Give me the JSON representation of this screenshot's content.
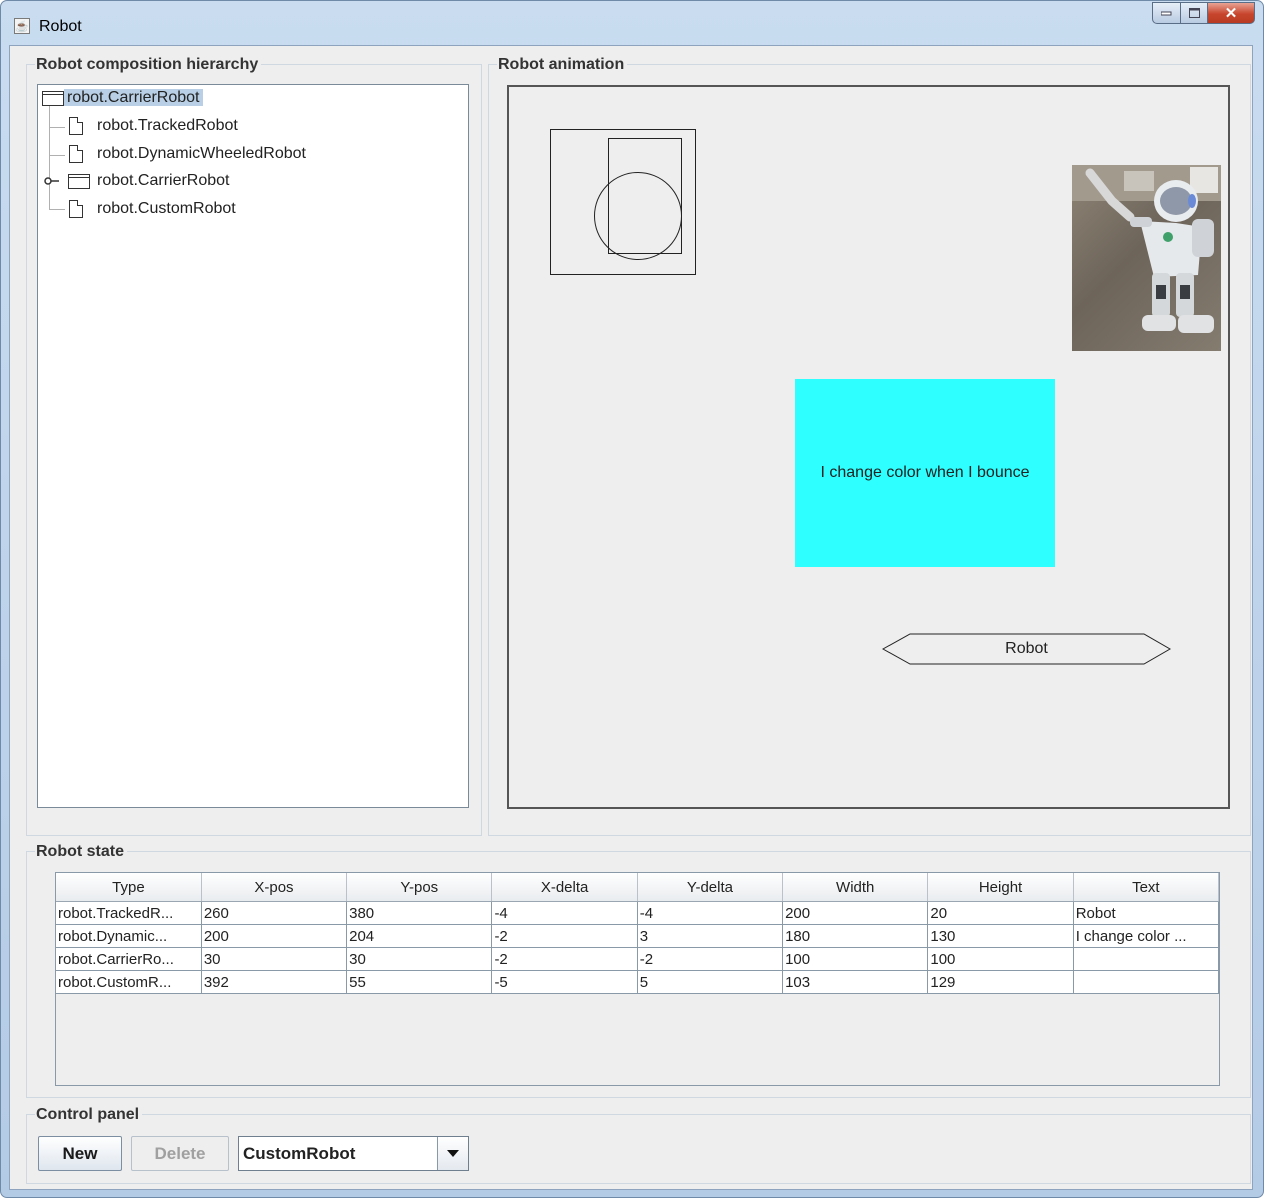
{
  "window": {
    "title": "Robot",
    "app_icon": "java-cup-icon"
  },
  "hierarchy": {
    "title": "Robot composition hierarchy",
    "root": "robot.CarrierRobot",
    "children": [
      "robot.TrackedRobot",
      "robot.DynamicWheeledRobot",
      "robot.CarrierRobot",
      "robot.CustomRobot"
    ]
  },
  "animation": {
    "title": "Robot animation",
    "dynamic_text": "I change color when I bounce",
    "dynamic_color": "#2effff",
    "tracked_text": "Robot"
  },
  "state": {
    "title": "Robot state",
    "columns": [
      "Type",
      "X-pos",
      "Y-pos",
      "X-delta",
      "Y-delta",
      "Width",
      "Height",
      "Text"
    ],
    "rows": [
      [
        "robot.TrackedR...",
        "260",
        "380",
        "-4",
        "-4",
        "200",
        "20",
        "Robot"
      ],
      [
        "robot.Dynamic...",
        "200",
        "204",
        "-2",
        "3",
        "180",
        "130",
        "I change color ..."
      ],
      [
        "robot.CarrierRo...",
        "30",
        "30",
        "-2",
        "-2",
        "100",
        "100",
        ""
      ],
      [
        "robot.CustomR...",
        "392",
        "55",
        "-5",
        "5",
        "103",
        "129",
        ""
      ]
    ]
  },
  "control": {
    "title": "Control panel",
    "new_label": "New",
    "delete_label": "Delete",
    "robot_type": "CustomRobot"
  }
}
